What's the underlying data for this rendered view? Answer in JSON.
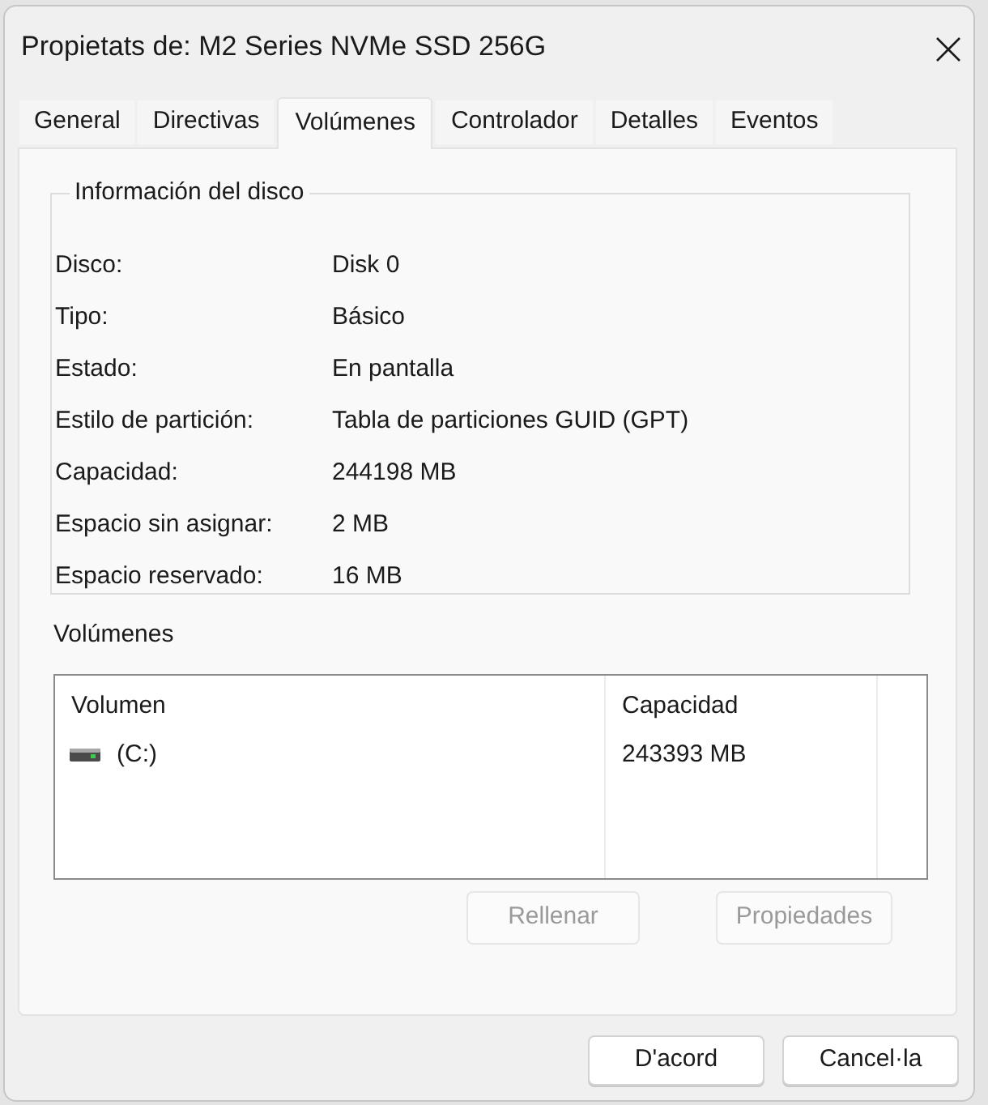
{
  "window": {
    "title": "Propietats de: M2 Series NVMe SSD 256G"
  },
  "tabs": [
    {
      "label": "General",
      "selected": false
    },
    {
      "label": "Directivas",
      "selected": false
    },
    {
      "label": "Volúmenes",
      "selected": true
    },
    {
      "label": "Controlador",
      "selected": false
    },
    {
      "label": "Detalles",
      "selected": false
    },
    {
      "label": "Eventos",
      "selected": false
    }
  ],
  "disk_info": {
    "title": "Información del disco",
    "rows": [
      {
        "label": "Disco:",
        "value": "Disk 0"
      },
      {
        "label": "Tipo:",
        "value": "Básico"
      },
      {
        "label": "Estado:",
        "value": "En pantalla"
      },
      {
        "label": "Estilo de partición:",
        "value": "Tabla de particiones GUID (GPT)"
      },
      {
        "label": "Capacidad:",
        "value": "244198 MB"
      },
      {
        "label": "Espacio sin asignar:",
        "value": "2 MB"
      },
      {
        "label": "Espacio reservado:",
        "value": "16 MB"
      }
    ]
  },
  "volumes": {
    "title": "Volúmenes",
    "columns": [
      "Volumen",
      "Capacidad"
    ],
    "rows": [
      {
        "cells": [
          "(C:)",
          "243393 MB"
        ]
      }
    ],
    "buttons": [
      {
        "label": "Rellenar",
        "disabled": true
      },
      {
        "label": "Propiedades",
        "disabled": true
      }
    ]
  },
  "dialog_buttons": [
    {
      "label": "D'acord"
    },
    {
      "label": "Cancel·la"
    }
  ]
}
